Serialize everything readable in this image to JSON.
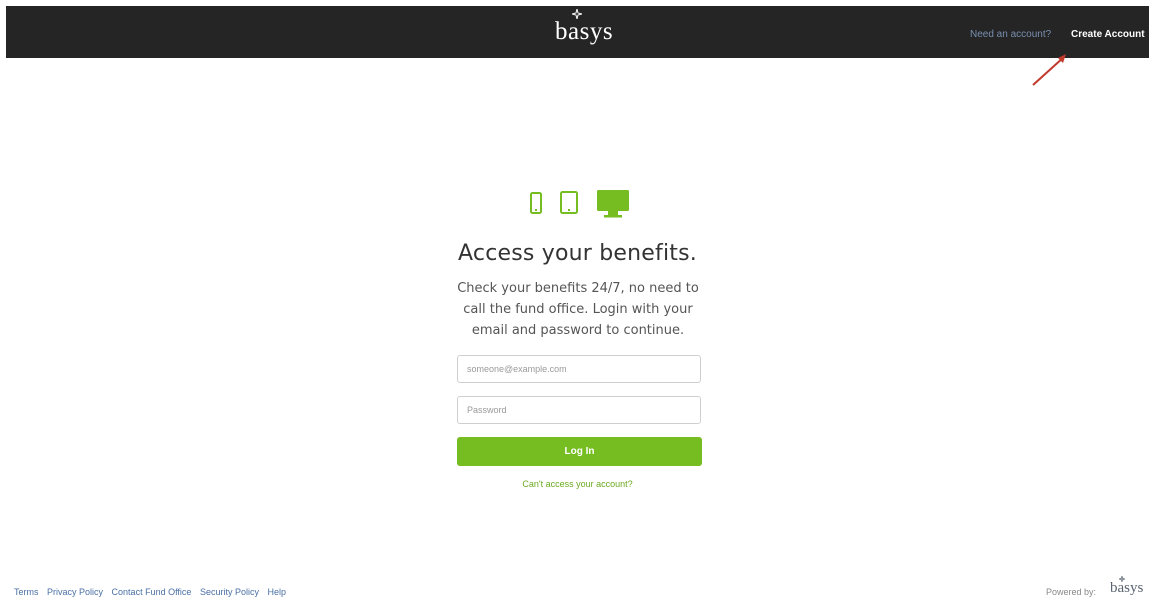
{
  "header": {
    "logo_text": "basys",
    "need_account": "Need an account?",
    "create_account": "Create Account"
  },
  "main": {
    "device_icons": [
      "mobile-icon",
      "tablet-icon",
      "desktop-icon"
    ],
    "headline": "Access your benefits.",
    "subtext": "Check your benefits 24/7, no need to call the fund office. Login with your email and password to continue.",
    "email_placeholder": "someone@example.com",
    "email_value": "",
    "password_placeholder": "Password",
    "password_value": "",
    "login_label": "Log In",
    "cant_access": "Can't access your account?"
  },
  "footer": {
    "links": [
      "Terms",
      "Privacy Policy",
      "Contact Fund Office",
      "Security Policy",
      "Help"
    ],
    "powered_by": "Powered by:",
    "powered_logo": "basys"
  },
  "colors": {
    "accent": "#76bd22",
    "header_bg": "#252525",
    "annotation_arrow": "#c0392b"
  }
}
